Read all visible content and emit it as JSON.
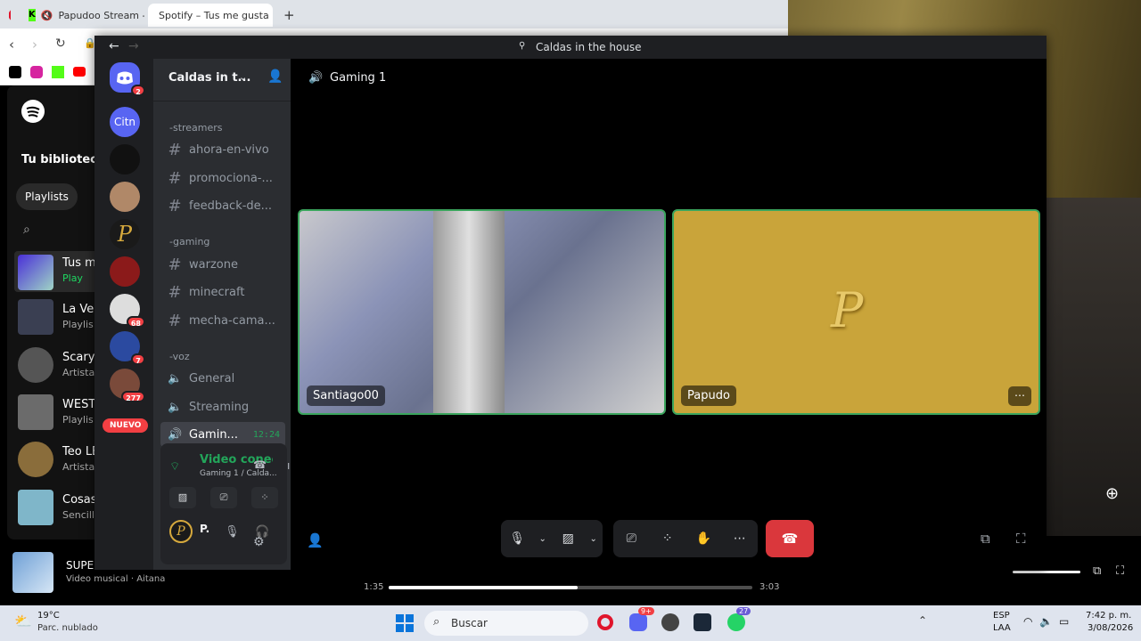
{
  "browser": {
    "tabs": [
      {
        "label": "Papudoo Stream - Wa"
      },
      {
        "label": "Spotify – Tus me gusta"
      }
    ],
    "new_tab": "+"
  },
  "spotify": {
    "library_title": "Tu biblioteca",
    "filter_chip": "Playlists",
    "items": [
      {
        "title": "Tus m",
        "sub": "Play"
      },
      {
        "title": "La Ver",
        "sub": "Playlis"
      },
      {
        "title": "Scary",
        "sub": "Artista"
      },
      {
        "title": "WEST",
        "sub": "Playlis"
      },
      {
        "title": "Teo LE",
        "sub": "Artista"
      },
      {
        "title": "Cosas",
        "sub": "Sencill"
      }
    ],
    "now_playing": {
      "title": "SUPER",
      "sub": "Video musical · Aitana"
    },
    "time_elapsed": "1:35",
    "time_total": "3:03",
    "progress": 0.52
  },
  "discord": {
    "window_title": "Caldas in the house",
    "server_name": "Caldas in t...",
    "guild_badges": {
      "home": "2",
      "g7": "68",
      "g8": "7",
      "g9": "277"
    },
    "new_label": "NUEVO",
    "categories": {
      "streamers": "-streamers",
      "gaming": "-gaming",
      "voz": "-voz"
    },
    "text_channels": [
      "ahora-en-vivo",
      "promociona-...",
      "feedback-de...",
      "warzone",
      "minecraft",
      "mecha-cama..."
    ],
    "voice_channels": [
      "General",
      "Streaming",
      "Gamin..."
    ],
    "active_voice_time": "12:24",
    "voice_panel": {
      "status": "Video conecta",
      "sub": "Gaming 1 / Calda..."
    },
    "user_short": "P.",
    "header_channel": "Gaming 1",
    "participants": [
      {
        "name": "Santiago00"
      },
      {
        "name": "Papudo"
      }
    ],
    "colors": {
      "accent_green": "#23a55a",
      "hangup": "#da373c",
      "papudo_bg": "#c9a43a"
    }
  },
  "taskbar": {
    "weather_temp": "19°C",
    "weather_desc": "Parc. nublado",
    "search_placeholder": "Buscar",
    "lang1": "ESP",
    "lang2": "LAA",
    "time": "7:42 p. m.",
    "date": "3/08/2026",
    "discord_badge": "9+",
    "whatsapp_badge": "27"
  }
}
